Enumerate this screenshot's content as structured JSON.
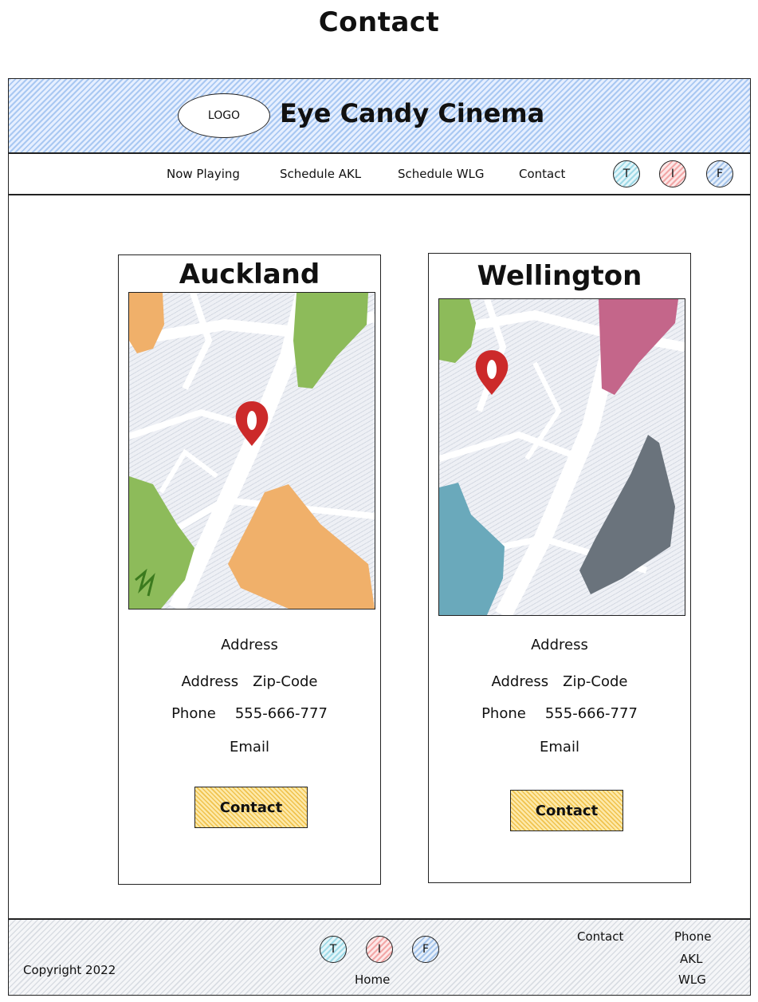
{
  "page_title": "Contact",
  "header": {
    "logo_label": "LOGO",
    "brand": "Eye Candy Cinema"
  },
  "nav": {
    "items": [
      {
        "label": "Now Playing"
      },
      {
        "label": "Schedule AKL"
      },
      {
        "label": "Schedule WLG"
      },
      {
        "label": "Contact"
      }
    ],
    "social": [
      {
        "label": "T"
      },
      {
        "label": "I"
      },
      {
        "label": "F"
      }
    ]
  },
  "locations": [
    {
      "name": "Auckland",
      "address_title": "Address",
      "address_label": "Address",
      "zip_label": "Zip-Code",
      "phone_label": "Phone",
      "phone_value": "555-666-777",
      "email_label": "Email",
      "button_label": "Contact"
    },
    {
      "name": "Wellington",
      "address_title": "Address",
      "address_label": "Address",
      "zip_label": "Zip-Code",
      "phone_label": "Phone",
      "phone_value": "555-666-777",
      "email_label": "Email",
      "button_label": "Contact"
    }
  ],
  "footer": {
    "copyright": "Copyright 2022",
    "social": [
      {
        "label": "T"
      },
      {
        "label": "I"
      },
      {
        "label": "F"
      }
    ],
    "home": "Home",
    "contact": "Contact",
    "phone": "Phone",
    "akl": "AKL",
    "wlg": "WLG"
  },
  "colors": {
    "header_hatch": "#a9c8f2",
    "button_fill": "#f0c24d",
    "pin": "#cc2a2a",
    "green": "#8dbb5a",
    "orange": "#f0b06a",
    "pink": "#c4668a",
    "teal": "#6aa9bb",
    "gray": "#6a737c"
  },
  "icons": {
    "map_pin": "map-pin-icon"
  }
}
